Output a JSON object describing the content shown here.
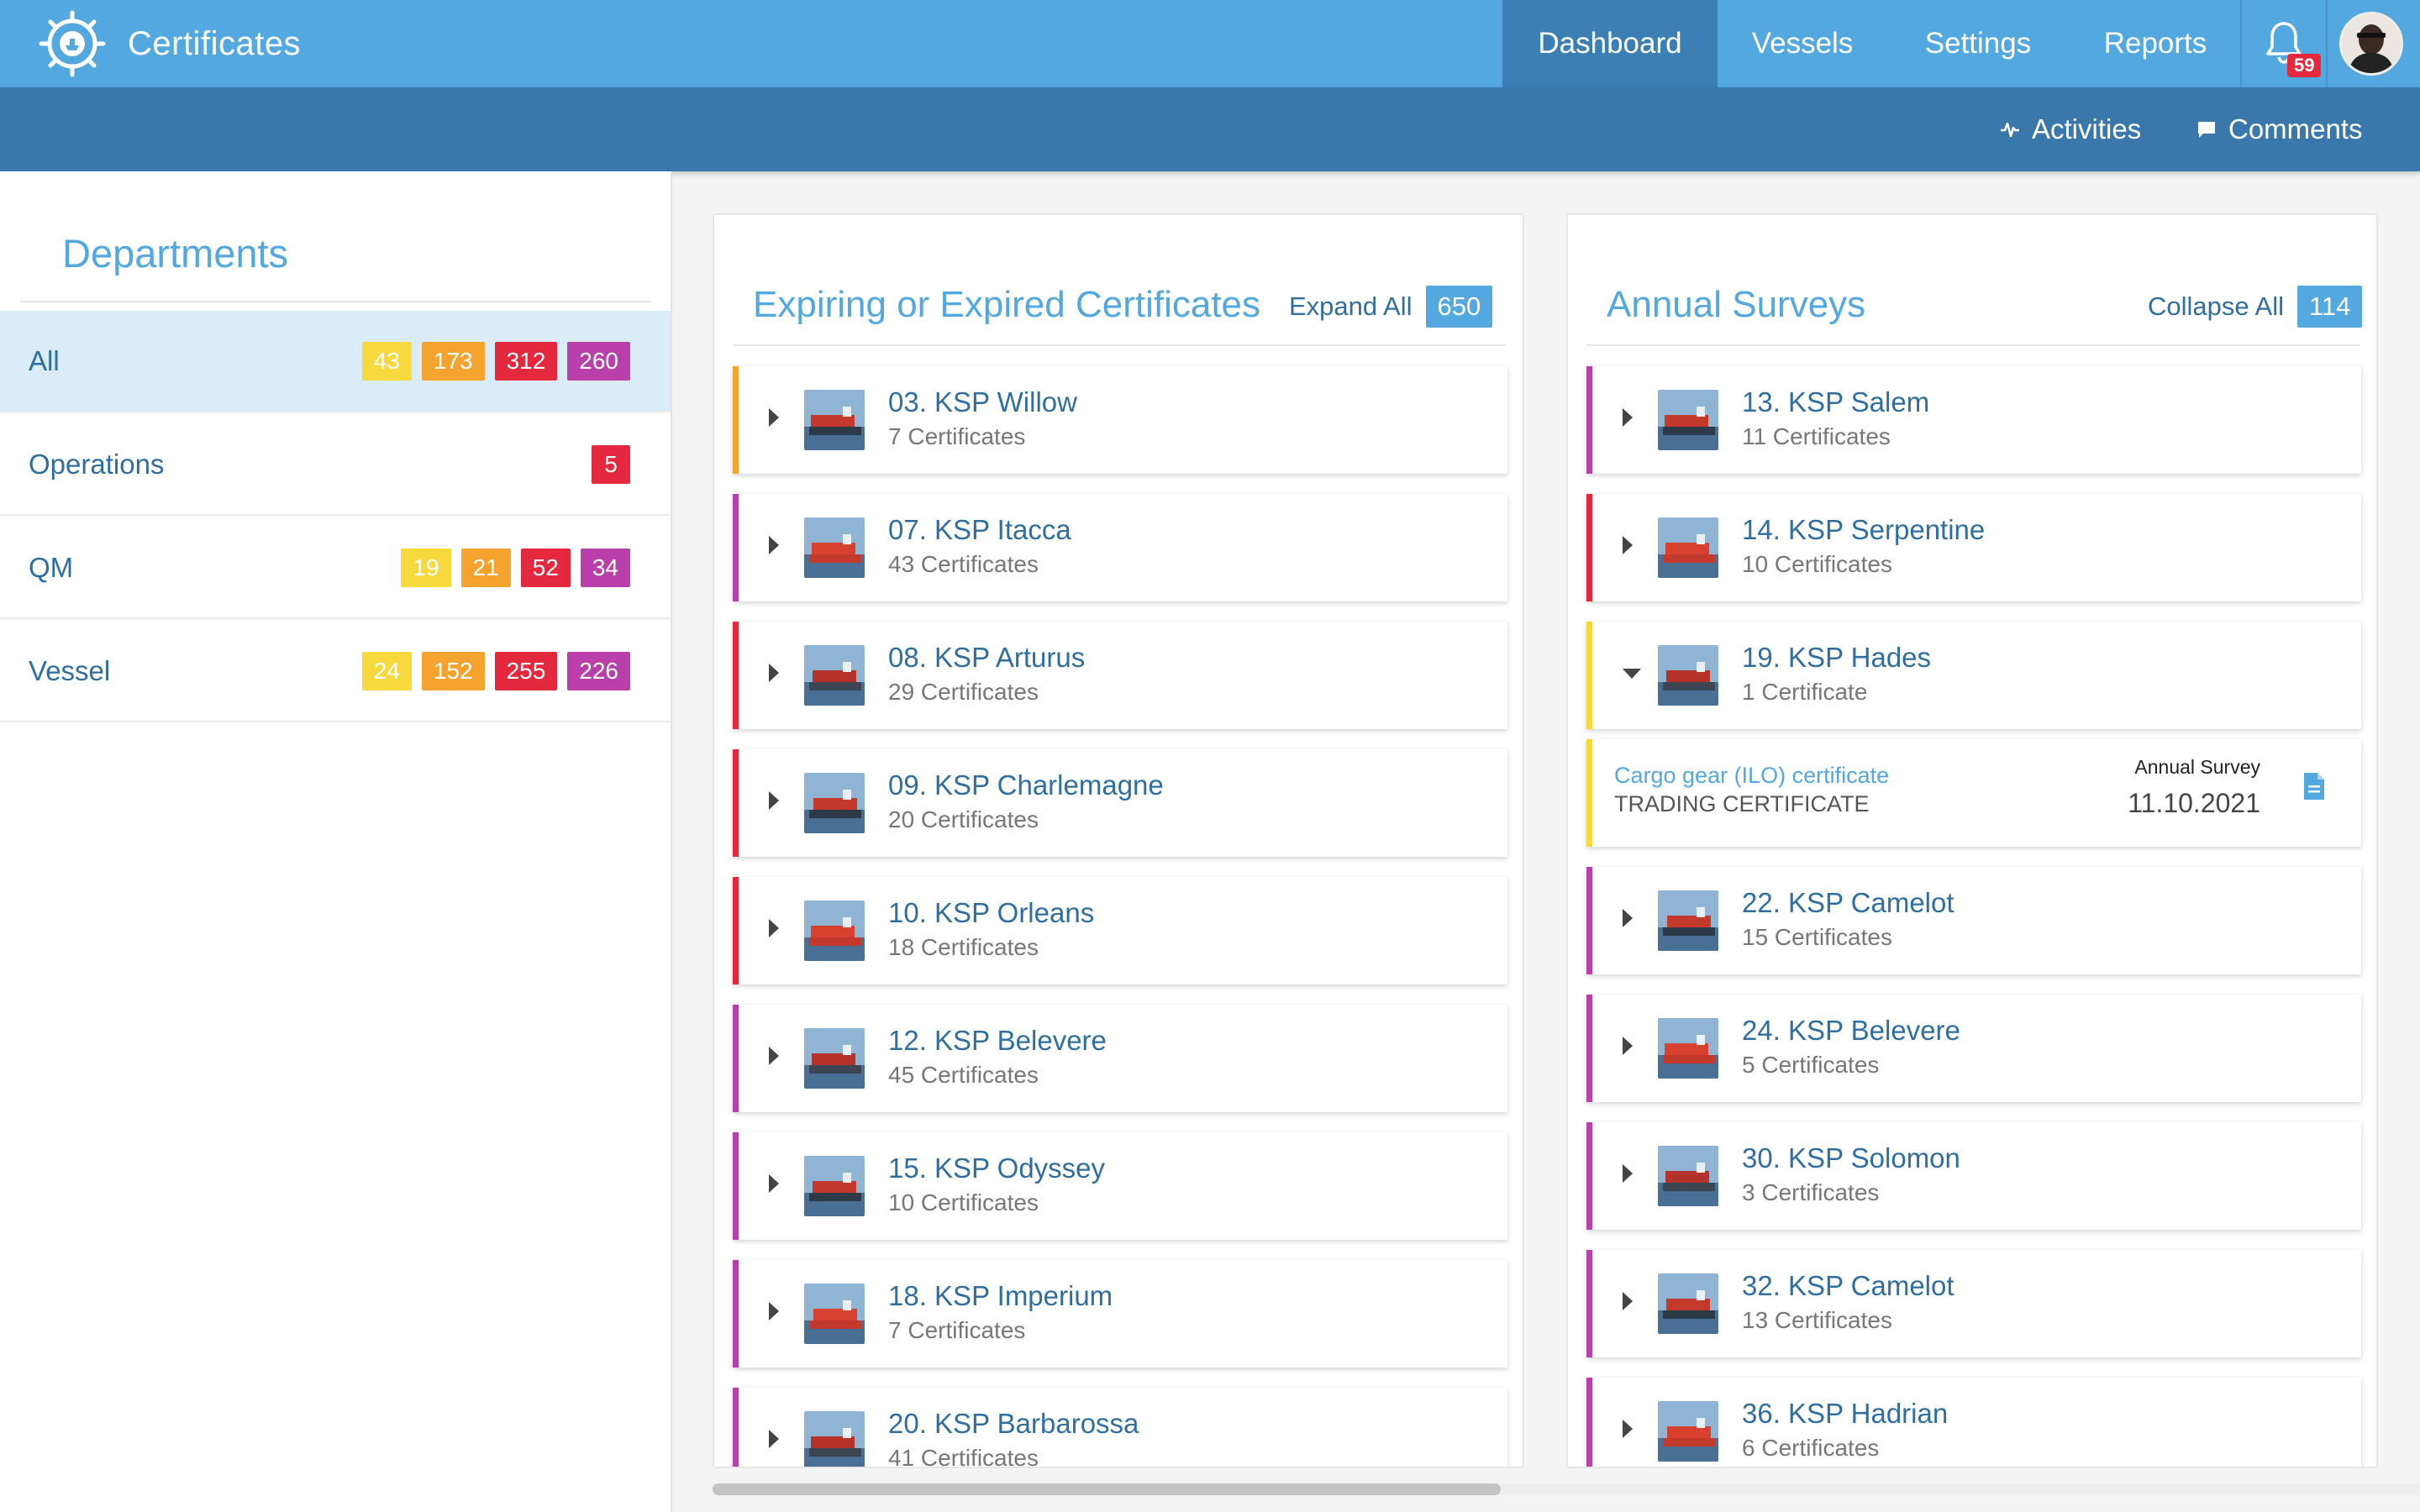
{
  "app": {
    "title": "Certificates"
  },
  "nav": {
    "items": [
      {
        "label": "Dashboard",
        "active": true
      },
      {
        "label": "Vessels",
        "active": false
      },
      {
        "label": "Settings",
        "active": false
      },
      {
        "label": "Reports",
        "active": false
      }
    ],
    "notifications_count": "59",
    "bell_icon": "bell-icon",
    "avatar": "user-avatar"
  },
  "subnav": {
    "activities_label": "Activities",
    "activities_icon": "pulse-icon",
    "comments_label": "Comments",
    "comments_icon": "comment-icon"
  },
  "departments": {
    "title": "Departments",
    "items": [
      {
        "name": "All",
        "active": true,
        "counts": {
          "yellow": "43",
          "orange": "173",
          "red": "312",
          "purple": "260"
        }
      },
      {
        "name": "Operations",
        "active": false,
        "counts": {
          "red": "5"
        }
      },
      {
        "name": "QM",
        "active": false,
        "counts": {
          "yellow": "19",
          "orange": "21",
          "red": "52",
          "purple": "34"
        }
      },
      {
        "name": "Vessel",
        "active": false,
        "counts": {
          "yellow": "24",
          "orange": "152",
          "red": "255",
          "purple": "226"
        }
      }
    ]
  },
  "expiring": {
    "title": "Expiring or Expired Certificates",
    "action_label": "Expand All",
    "count": "650",
    "vessels": [
      {
        "name": "03. KSP Willow",
        "count": "7 Certificates",
        "status": "orange"
      },
      {
        "name": "07. KSP Itacca",
        "count": "43 Certificates",
        "status": "purple"
      },
      {
        "name": "08. KSP Arturus",
        "count": "29 Certificates",
        "status": "red"
      },
      {
        "name": "09. KSP Charlemagne",
        "count": "20 Certificates",
        "status": "red"
      },
      {
        "name": "10. KSP Orleans",
        "count": "18 Certificates",
        "status": "red"
      },
      {
        "name": "12. KSP Belevere",
        "count": "45 Certificates",
        "status": "purple"
      },
      {
        "name": "15. KSP Odyssey",
        "count": "10 Certificates",
        "status": "purple"
      },
      {
        "name": "18. KSP Imperium",
        "count": "7 Certificates",
        "status": "purple"
      },
      {
        "name": "20. KSP Barbarossa",
        "count": "41 Certificates",
        "status": "purple"
      }
    ]
  },
  "annual": {
    "title": "Annual Surveys",
    "action_label": "Collapse All",
    "count": "114",
    "vessels": [
      {
        "name": "13. KSP Salem",
        "count": "11 Certificates",
        "status": "purple"
      },
      {
        "name": "14. KSP Serpentine",
        "count": "10 Certificates",
        "status": "red"
      },
      {
        "name": "19. KSP Hades",
        "count": "1 Certificate",
        "status": "yellow",
        "expanded": true
      },
      {
        "name": "22. KSP Camelot",
        "count": "15 Certificates",
        "status": "purple"
      },
      {
        "name": "24. KSP Belevere",
        "count": "5 Certificates",
        "status": "purple"
      },
      {
        "name": "30. KSP Solomon",
        "count": "3 Certificates",
        "status": "purple"
      },
      {
        "name": "32. KSP Camelot",
        "count": "13 Certificates",
        "status": "purple"
      },
      {
        "name": "36. KSP Hadrian",
        "count": "6 Certificates",
        "status": "purple"
      }
    ],
    "expanded_certificate": {
      "name": "Cargo gear (ILO) certificate",
      "type": "TRADING CERTIFICATE",
      "label": "Annual Survey",
      "date": "11.10.2021",
      "icon": "document-icon"
    }
  },
  "colors": {
    "primary": "#52a8df",
    "primary_dark": "#3a78ac",
    "yellow": "#f8d93d",
    "orange": "#f4a32f",
    "red": "#e4283d",
    "purple": "#b93fab"
  }
}
